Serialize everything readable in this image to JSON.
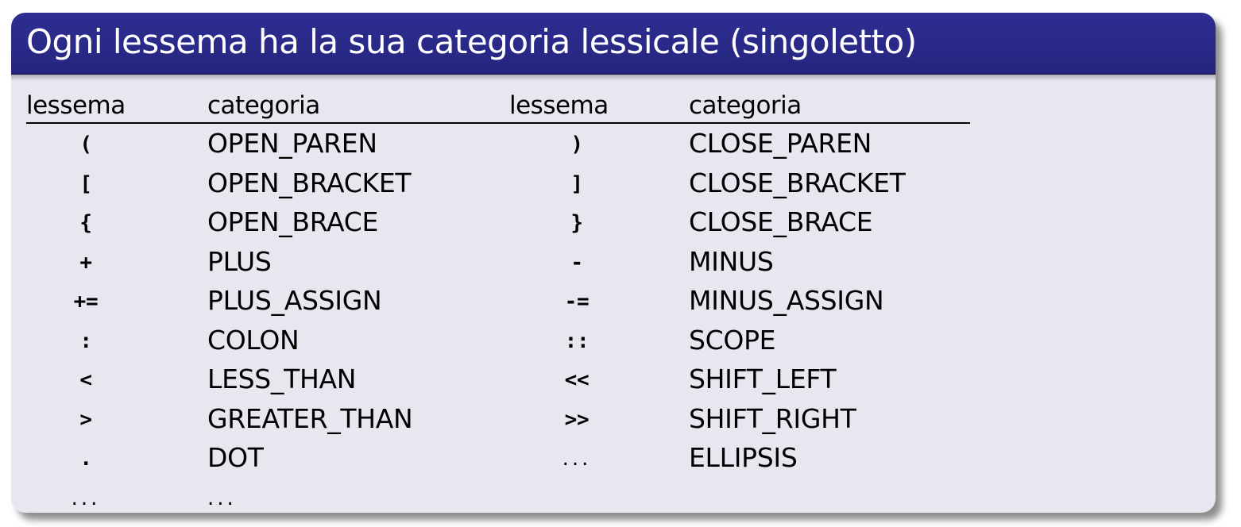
{
  "slide": {
    "title": "Ogni lessema ha la sua categoria lessicale (singoletto)"
  },
  "table": {
    "headers": [
      "lessema",
      "categoria",
      "lessema",
      "categoria"
    ],
    "rows": [
      [
        "(",
        "OPEN_PAREN",
        ")",
        "CLOSE_PAREN"
      ],
      [
        "[",
        "OPEN_BRACKET",
        "]",
        "CLOSE_BRACKET"
      ],
      [
        "{",
        "OPEN_BRACE",
        "}",
        "CLOSE_BRACE"
      ],
      [
        "+",
        "PLUS",
        "-",
        "MINUS"
      ],
      [
        "+=",
        "PLUS_ASSIGN",
        "-=",
        "MINUS_ASSIGN"
      ],
      [
        ":",
        "COLON",
        "::",
        "SCOPE"
      ],
      [
        "<",
        "LESS_THAN",
        "<<",
        "SHIFT_LEFT"
      ],
      [
        ">",
        "GREATER_THAN",
        ">>",
        "SHIFT_RIGHT"
      ],
      [
        ".",
        "DOT",
        "...",
        "ELLIPSIS"
      ],
      [
        "...",
        "...",
        "",
        ""
      ]
    ]
  }
}
